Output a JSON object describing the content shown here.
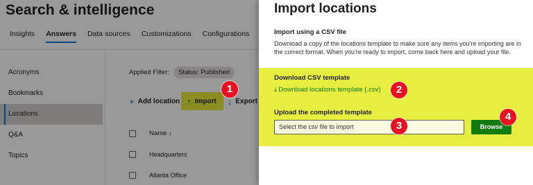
{
  "page": {
    "title": "Search & intelligence",
    "tabs": [
      "Insights",
      "Answers",
      "Data sources",
      "Customizations",
      "Configurations"
    ]
  },
  "left_nav": [
    "Acronyms",
    "Bookmarks",
    "Locations",
    "Q&A",
    "Topics"
  ],
  "filter": {
    "label": "Applied Filter:",
    "pill": "Status: Published"
  },
  "toolbar": {
    "add_label": "Add location",
    "import_label": "Import",
    "export_label": "Export"
  },
  "table": {
    "name_header": "Name ↓",
    "rows": [
      "Headquarters",
      "Atlanta Office"
    ]
  },
  "panel": {
    "title": "Import locations",
    "csv_section_title": "Import using a CSV file",
    "csv_description": "Download a copy of the locations template to make sure any items you're importing are in the correct format. When you're ready to import, come back here and upload your file.",
    "download_title": "Download CSV template",
    "download_link": "Download locations template (.csv)",
    "upload_title": "Upload the completed template",
    "file_placeholder": "Select the csv file to import",
    "browse_label": "Browse"
  },
  "markers": [
    "1",
    "2",
    "3",
    "4"
  ],
  "colors": {
    "accent_blue": "#0078d4",
    "highlight_yellow": "#e8ee3f",
    "browse_green": "#107c10",
    "marker_red": "#e81123"
  }
}
